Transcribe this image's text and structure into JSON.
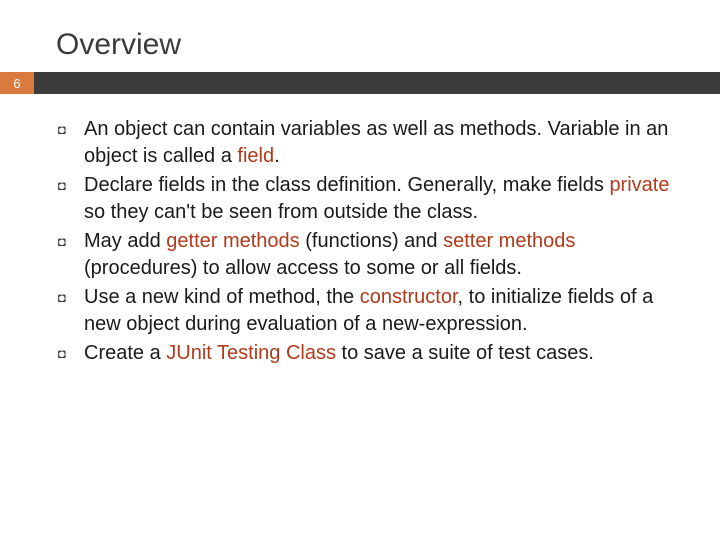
{
  "title": "Overview",
  "slide_number": "6",
  "bullets": {
    "b0": {
      "pre": "An object can contain variables as well as methods. Variable in an object is called a ",
      "hl": "field",
      "post": "."
    },
    "b1": {
      "pre": "Declare fields in the class definition. Generally, make fields ",
      "hl": "private",
      "post": " so they can't be seen from outside the class."
    },
    "b2": {
      "pre": "May add ",
      "hl1": "getter methods",
      "mid": " (functions) and ",
      "hl2": "setter methods",
      "post": " (procedures) to allow access to some or all fields."
    },
    "b3": {
      "pre": "Use a new kind of method, the ",
      "hl": "constructor",
      "post": ", to initialize fields of a new object during evaluation of a new-expression."
    },
    "b4": {
      "pre": "Create a ",
      "hl": "JUnit Testing Class",
      "post": " to save a suite of test cases."
    }
  },
  "glyph": "◘"
}
